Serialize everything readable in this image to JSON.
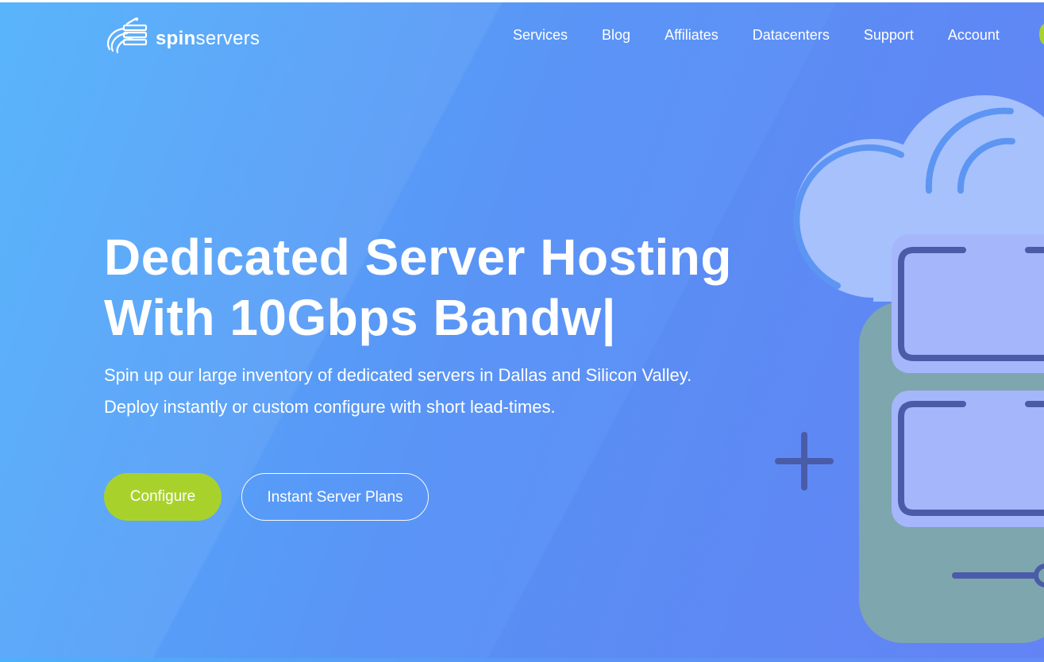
{
  "brand": {
    "name_bold": "spin",
    "name_rest": "servers"
  },
  "nav": {
    "items": [
      {
        "label": "Services"
      },
      {
        "label": "Blog"
      },
      {
        "label": "Affiliates"
      },
      {
        "label": "Datacenters"
      },
      {
        "label": "Support"
      },
      {
        "label": "Account"
      }
    ]
  },
  "hero": {
    "title_line1": "Dedicated Server Hosting",
    "title_line2": "With 10Gbps Bandw|",
    "subtitle_line1": "Spin up our large inventory of dedicated servers in Dallas and Silicon Valley.",
    "subtitle_line2": "Deploy instantly or custom configure with short lead-times."
  },
  "buttons": {
    "configure": "Configure",
    "instant_plans": "Instant Server Plans"
  },
  "colors": {
    "accent_green": "#a8d22b",
    "bg_blue_start": "#4fb0fb",
    "bg_blue_end": "#6787f7",
    "server_stroke": "#4a5ca8",
    "cloud_fill": "#a8c3fd"
  },
  "illustration": {
    "icons": [
      "cloud-icon",
      "server-rack-icon",
      "plus-icon"
    ]
  }
}
